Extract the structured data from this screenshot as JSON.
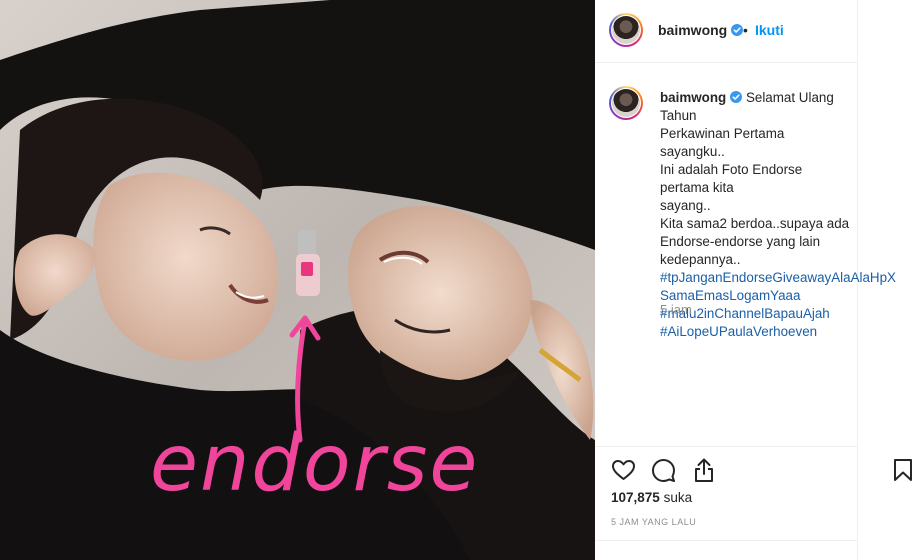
{
  "post": {
    "username": "baimwong",
    "follow_separator": "•",
    "follow_label": "Ikuti",
    "caption_lines": [
      "Selamat Ulang Tahun",
      "Perkawinan Pertama sayangku..",
      "Ini adalah Foto Endorse pertama kita",
      "sayang..",
      "Kita sama2 berdoa..supaya ada",
      "Endorse-endorse yang lain",
      "kedepannya.."
    ],
    "hashtags": [
      "#tpJanganEndorseGiveawayAlaAlaHpX",
      "SamaEmasLogamYaaa",
      "#malu2inChannelBapauAjah",
      "#AiLopeUPaulaVerhoeven"
    ],
    "comment_age": "5 iam",
    "likes_count": "107,875",
    "likes_label": "suka",
    "timestamp": "5 JAM YANG LALU",
    "photo_overlay_text": "endorse",
    "colors": {
      "accent": "#0095f6",
      "hashtag": "#1b5fa8",
      "overlay": "#f0459b",
      "muted": "#8e8e8e"
    },
    "icons": [
      "verified-badge-icon",
      "heart-icon",
      "comment-icon",
      "share-icon",
      "bookmark-icon"
    ]
  }
}
